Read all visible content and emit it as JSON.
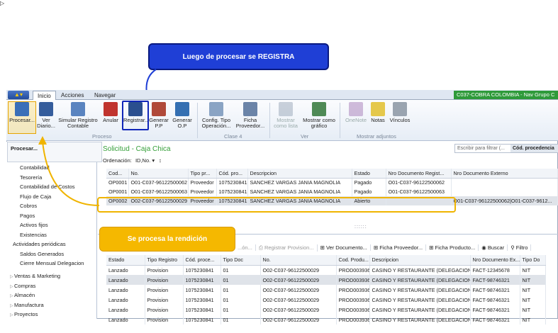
{
  "callouts": {
    "top": "Luego de procesar se REGISTRA",
    "bottom": "Se procesa la rendición"
  },
  "tabs": [
    "Inicio",
    "Acciones",
    "Navegar"
  ],
  "company": "C037-COBRA COLOMBIA - Nav Grupo C",
  "ribbon": {
    "buttons": [
      {
        "l1": "Procesar...",
        "l2": "",
        "color": "#3a6fb8"
      },
      {
        "l1": "Ver",
        "l2": "Diario...",
        "color": "#355d9c"
      },
      {
        "l1": "Simular Registro",
        "l2": "Contable",
        "color": "#5a84c0"
      },
      {
        "l1": "Anular",
        "l2": "",
        "color": "#c0342e"
      },
      {
        "l1": "Registrar...",
        "l2": "",
        "color": "#2b4f8f"
      },
      {
        "l1": "Generar",
        "l2": "P.P",
        "color": "#b04a3a"
      },
      {
        "l1": "Generar",
        "l2": "O.P",
        "color": "#3570b2"
      },
      {
        "l1": "Config. Tipo",
        "l2": "Operación...",
        "color": "#8aa4c4"
      },
      {
        "l1": "Ficha",
        "l2": "Proveedor...",
        "color": "#6b84a8"
      },
      {
        "l1": "Mostrar",
        "l2": "como lista",
        "color": "#8c9cb0"
      },
      {
        "l1": "Mostrar como",
        "l2": "gráfico",
        "color": "#4f8a56"
      },
      {
        "l1": "OneNote",
        "l2": "",
        "color": "#9c6cb0"
      },
      {
        "l1": "Notas",
        "l2": "",
        "color": "#e5c84c"
      },
      {
        "l1": "Vínculos",
        "l2": "",
        "color": "#9aa4b0"
      }
    ],
    "groups": [
      "Proceso",
      "Clase 4",
      "Ver",
      "Mostrar adjuntos"
    ]
  },
  "tooltip": "Procesar...",
  "nav": {
    "items": [
      "Contabilidad",
      "Tesorería",
      "Contabilidad de Costos",
      "Flujo de Caja",
      "Cobros",
      "Pagos",
      "Activos fijos",
      "Existencias",
      "Actividades periódicas",
      "Saldos Generados",
      "Cierre Mensual Delegacion"
    ],
    "groups": [
      "Ventas & Marketing",
      "Compras",
      "Almacén",
      "Manufactura",
      "Proyectos"
    ]
  },
  "page": {
    "title": "Solicitud - Caja Chica",
    "filter_placeholder": "Escribir para filtrar (...",
    "filter_field": "Cód. procedencia",
    "ordenacion_label": "Ordenación:",
    "ordenacion_value": "ID,No."
  },
  "grid1": {
    "headers": [
      "Cod...",
      "No.",
      "Tipo pr...",
      "Cód. pro...",
      "Descripcion",
      "Estado",
      "Nro Documento Regist...",
      "Nro Documento Externo"
    ],
    "rows": [
      [
        "OP0001",
        "O01-C037-96122500062",
        "Proveedor",
        "1075230841",
        "SANCHEZ VARGAS JANIA MAGNOLIA",
        "Pagado",
        "O01-C037-96122500062",
        ""
      ],
      [
        "OP0001",
        "O01-C037-96122500063",
        "Proveedor",
        "1075230841",
        "SANCHEZ VARGAS JANIA MAGNOLIA",
        "Pagado",
        "O01-C037-96122500063",
        ""
      ],
      [
        "OP0002",
        "O02-C037-96122500029",
        "Proveedor",
        "1075230841",
        "SANCHEZ VARGAS JANIA MAGNOLIA",
        "Abierto",
        "",
        "O01-C037-96122500062|O01-C037-9612..."
      ]
    ]
  },
  "toolbar2": [
    "...ón...",
    "Registrar Provision...",
    "Ver Documento...",
    "Ficha Proveedor...",
    "Ficha Producto...",
    "Buscar",
    "Filtro"
  ],
  "grid2": {
    "headers": [
      "Estado",
      "Tipo Registro",
      "Cód. proce...",
      "Tipo Doc",
      "No.",
      "Cod. Produ...",
      "Descripcion",
      "Nro Documento Ex...",
      "Tipo Do"
    ],
    "rows": [
      [
        "Lanzado",
        "Provision",
        "1075230841",
        "01",
        "O02-C037-96122500029",
        "PROD003936",
        "CASINO Y RESTAURANTE (DELEGACION)",
        "FACT-12345678",
        "NIT"
      ],
      [
        "Lanzado",
        "Provision",
        "1075230841",
        "01",
        "O02-C037-96122500029",
        "PROD003936",
        "CASINO Y RESTAURANTE (DELEGACION)",
        "FACT-98746321",
        "NIT"
      ],
      [
        "Lanzado",
        "Provision",
        "1075230841",
        "01",
        "O02-C037-96122500029",
        "PROD003936",
        "CASINO Y RESTAURANTE (DELEGACION)",
        "FACT-98746321",
        "NIT"
      ],
      [
        "Lanzado",
        "Provision",
        "1075230841",
        "01",
        "O02-C037-96122500029",
        "PROD003936",
        "CASINO Y RESTAURANTE (DELEGACION)",
        "FACT-98746321",
        "NIT"
      ],
      [
        "Lanzado",
        "Provision",
        "1075230841",
        "01",
        "O02-C037-96122500029",
        "PROD003936",
        "CASINO Y RESTAURANTE (DELEGACION)",
        "FACT-98746321",
        "NIT"
      ],
      [
        "Lanzado",
        "Provision",
        "1075230841",
        "01",
        "O02-C037-96122500029",
        "PROD003936",
        "CASINO Y RESTAURANTE (DELEGACION)",
        "FACT-98746321",
        "NIT"
      ]
    ]
  }
}
